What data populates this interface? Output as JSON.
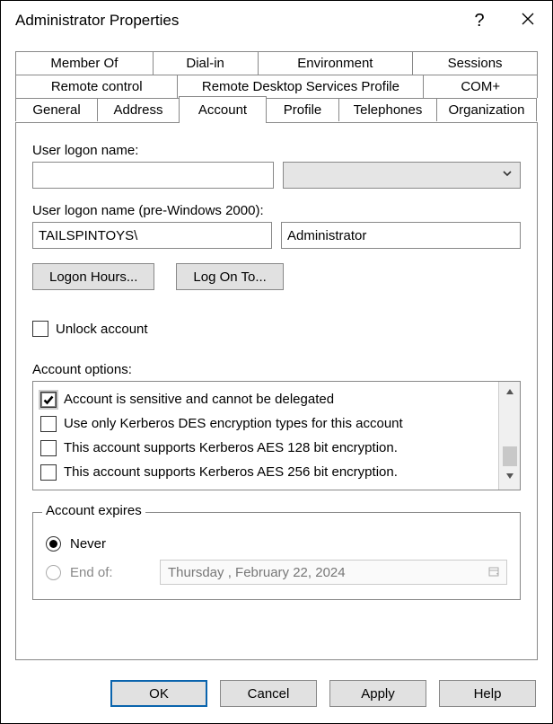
{
  "title": "Administrator Properties",
  "tabs": {
    "row1": [
      "Member Of",
      "Dial-in",
      "Environment",
      "Sessions"
    ],
    "row2": [
      "Remote control",
      "Remote Desktop Services Profile",
      "COM+"
    ],
    "row3": [
      "General",
      "Address",
      "Account",
      "Profile",
      "Telephones",
      "Organization"
    ]
  },
  "labels": {
    "logon_name": "User logon name:",
    "logon_pre2000": "User logon name (pre-Windows 2000):",
    "account_options": "Account options:",
    "account_expires": "Account expires"
  },
  "fields": {
    "logon_name": "",
    "domain_prefix": "TAILSPINTOYS\\",
    "username": "Administrator"
  },
  "buttons": {
    "logon_hours": "Logon Hours...",
    "log_on_to": "Log On To...",
    "ok": "OK",
    "cancel": "Cancel",
    "apply": "Apply",
    "help": "Help"
  },
  "checkboxes": {
    "unlock": {
      "label": "Unlock account",
      "checked": false
    }
  },
  "options": [
    {
      "label": "Account is sensitive and cannot be delegated",
      "checked": true
    },
    {
      "label": "Use only Kerberos DES encryption types for this account",
      "checked": false
    },
    {
      "label": "This account supports Kerberos AES 128 bit encryption.",
      "checked": false
    },
    {
      "label": "This account supports Kerberos AES 256 bit encryption.",
      "checked": false
    }
  ],
  "expires": {
    "never": "Never",
    "end_of": "End of:",
    "date": "Thursday ,   February  22, 2024",
    "selected": "never"
  }
}
